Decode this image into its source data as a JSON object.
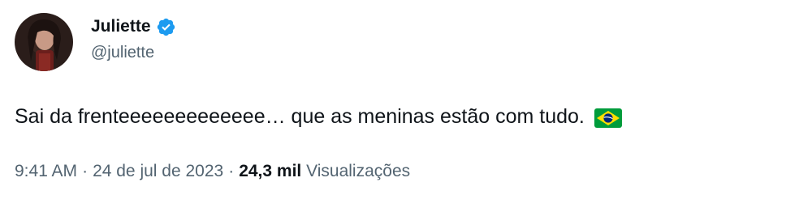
{
  "author": {
    "display_name": "Juliette",
    "handle": "@juliette",
    "verified_icon": "verified-badge-icon"
  },
  "tweet": {
    "text": "Sai da frenteeeeeeeeeeeee… que as meninas estão com tudo.",
    "emoji": "brazil-flag-icon"
  },
  "meta": {
    "time": "9:41 AM",
    "separator": "·",
    "date": "24 de jul de 2023",
    "views_count": "24,3 mil",
    "views_label": "Visualizações"
  },
  "colors": {
    "text_primary": "#0f1419",
    "text_secondary": "#536471",
    "verified_blue": "#1d9bf0",
    "background": "#ffffff"
  }
}
